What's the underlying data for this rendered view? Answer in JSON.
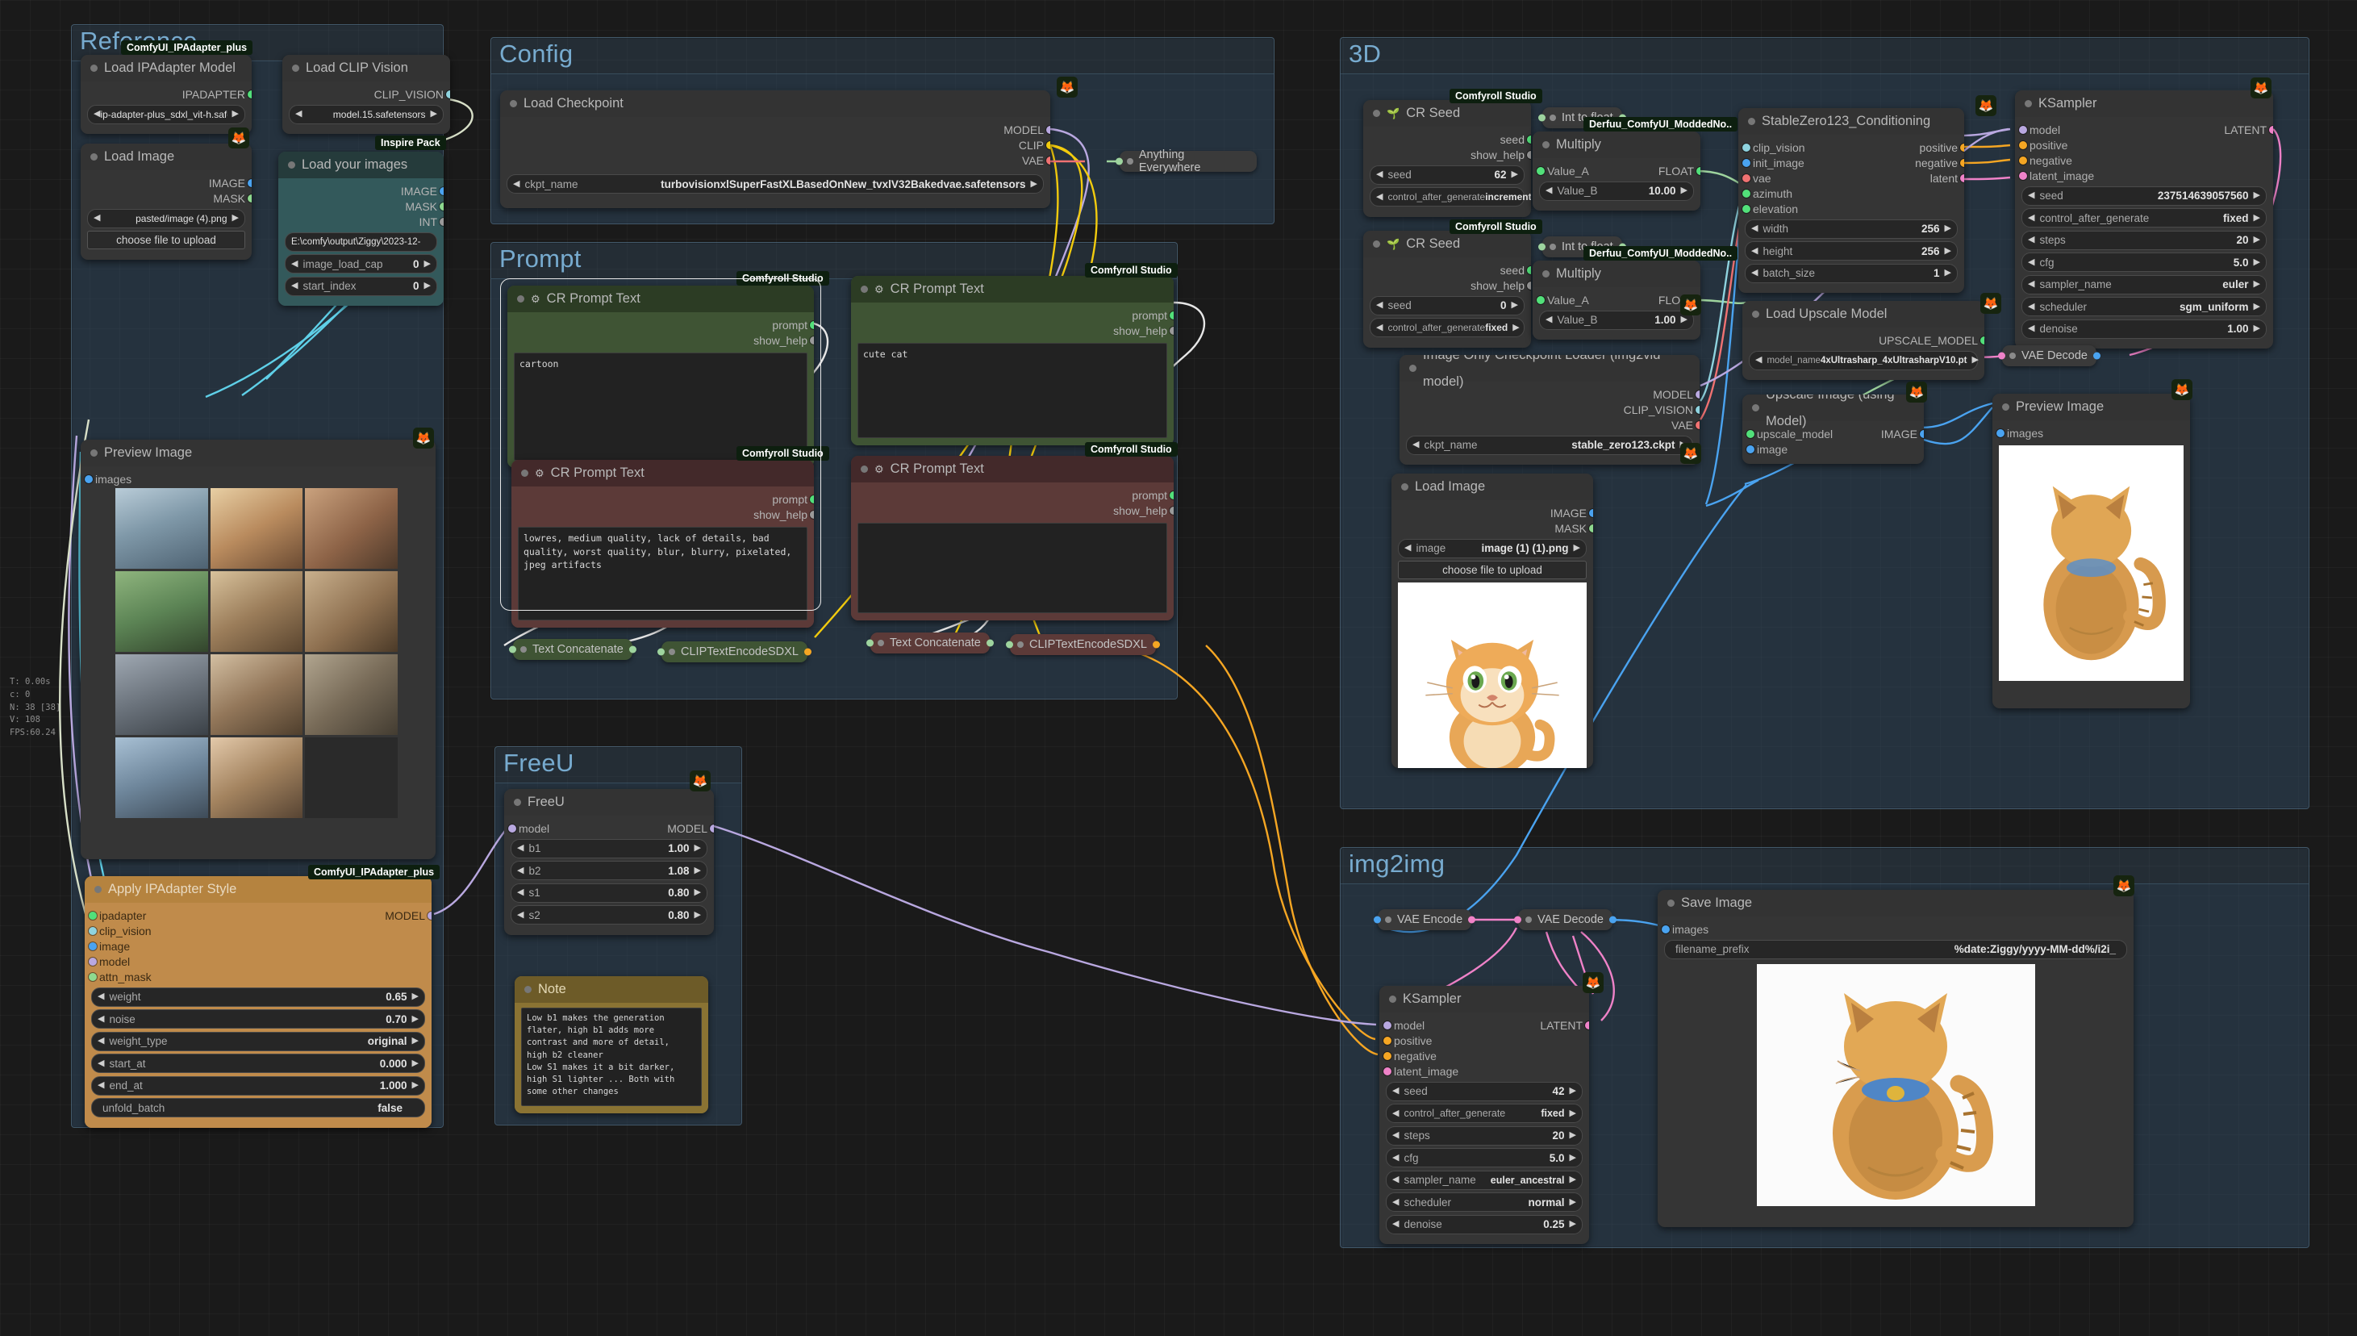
{
  "groups": [
    {
      "title": "Reference"
    },
    {
      "title": "Config"
    },
    {
      "title": "Prompt"
    },
    {
      "title": "FreeU"
    },
    {
      "title": "3D"
    },
    {
      "title": "img2img"
    }
  ],
  "badges": {
    "ipadapter_plus": "ComfyUI_IPAdapter_plus",
    "inspire_pack": "Inspire Pack",
    "comfyroll": "Comfyroll Studio",
    "derfuu": "Derfuu_ComfyUI_ModdedNo.."
  },
  "reference": {
    "load_ipadapter_model": {
      "title": "Load IPAdapter Model",
      "output": "IPADAPTER",
      "ipadapter_file": "ip-adapter-plus_sdxl_vit-h.safetensors"
    },
    "load_image": {
      "title": "Load Image",
      "out_image": "IMAGE",
      "out_mask": "MASK",
      "image_value": "pasted/image (4).png",
      "upload_label": "choose file to upload"
    },
    "load_clip_vision": {
      "title": "Load CLIP Vision",
      "output": "CLIP_VISION",
      "clip_name": "model.15.safetensors"
    },
    "load_your_images": {
      "title": "Load your images",
      "out_image": "IMAGE",
      "out_mask": "MASK",
      "out_int": "INT",
      "directory": "E:\\comfy\\output\\Ziggy\\2023-12-",
      "image_load_cap_label": "image_load_cap",
      "image_load_cap": "0",
      "start_index_label": "start_index",
      "start_index": "0"
    },
    "preview_image": {
      "title": "Preview Image",
      "input": "images"
    },
    "apply_ipadapter_style": {
      "title": "Apply IPAdapter Style",
      "inputs": [
        "ipadapter",
        "clip_vision",
        "image",
        "model",
        "attn_mask"
      ],
      "output": "MODEL",
      "widgets": [
        {
          "label": "weight",
          "value": "0.65"
        },
        {
          "label": "noise",
          "value": "0.70"
        },
        {
          "label": "weight_type",
          "value": "original"
        },
        {
          "label": "start_at",
          "value": "0.000"
        },
        {
          "label": "end_at",
          "value": "1.000"
        }
      ],
      "toggle_label": "unfold_batch",
      "toggle_value": "false"
    },
    "stats": "T: 0.00s\nc: 0\nN: 38 [38]\nV: 108\nFPS:60.24"
  },
  "config": {
    "load_checkpoint": {
      "title": "Load Checkpoint",
      "outputs": [
        "MODEL",
        "CLIP",
        "VAE"
      ],
      "ckpt_label": "ckpt_name",
      "ckpt_name": "turbovisionxlSuperFastXLBasedOnNew_tvxlV32Bakedvae.safetensors"
    },
    "anything_everywhere": {
      "title": "Anything Everywhere"
    }
  },
  "prompt": {
    "nodes": [
      {
        "title": "CR Prompt Text",
        "out1": "prompt",
        "out2": "show_help",
        "text": "cartoon",
        "color": "green"
      },
      {
        "title": "CR Prompt Text",
        "out1": "prompt",
        "out2": "show_help",
        "text": "cute cat",
        "color": "green"
      },
      {
        "title": "CR Prompt Text",
        "out1": "prompt",
        "out2": "show_help",
        "text": "lowres, medium quality, lack of details, bad quality, worst quality, blur, blurry, pixelated, jpeg artifacts",
        "color": "red"
      },
      {
        "title": "CR Prompt Text",
        "out1": "prompt",
        "out2": "show_help",
        "text": "",
        "color": "red"
      }
    ],
    "concat_pos": "Text Concatenate",
    "encode_pos": "CLIPTextEncodeSDXL",
    "concat_neg": "Text Concatenate",
    "encode_neg": "CLIPTextEncodeSDXL"
  },
  "freeu": {
    "node": {
      "title": "FreeU",
      "input": "model",
      "output": "MODEL",
      "widgets": [
        {
          "label": "b1",
          "value": "1.00"
        },
        {
          "label": "b2",
          "value": "1.08"
        },
        {
          "label": "s1",
          "value": "0.80"
        },
        {
          "label": "s2",
          "value": "0.80"
        }
      ]
    },
    "note": {
      "title": "Note",
      "text": "Low b1 makes the generation flater, high b1 adds more contrast and more of detail,\nhigh b2 cleaner\nLow S1 makes it a bit darker, high S1 lighter ... Both with some other changes"
    }
  },
  "threed": {
    "cr_seed_1": {
      "title": "CR Seed",
      "out_seed": "seed",
      "out_help": "show_help",
      "seed_label": "seed",
      "seed_value": "62",
      "control_label": "control_after_generate",
      "control_value": "increment"
    },
    "cr_seed_2": {
      "title": "CR Seed",
      "out_seed": "seed",
      "out_help": "show_help",
      "seed_label": "seed",
      "seed_value": "0",
      "control_label": "control_after_generate",
      "control_value": "fixed"
    },
    "int_to_float_1": {
      "title": "Int to float"
    },
    "int_to_float_2": {
      "title": "Int to float"
    },
    "multiply_1": {
      "title": "Multiply",
      "input": "Value_A",
      "output": "FLOAT",
      "value_b_label": "Value_B",
      "value_b": "10.00"
    },
    "multiply_2": {
      "title": "Multiply",
      "input": "Value_A",
      "output": "FLOAT",
      "value_b_label": "Value_B",
      "value_b": "1.00"
    },
    "stablezero123": {
      "title": "StableZero123_Conditioning",
      "inputs": [
        "clip_vision",
        "init_image",
        "vae",
        "azimuth",
        "elevation"
      ],
      "outputs": [
        "positive",
        "negative",
        "latent"
      ],
      "widgets": [
        {
          "label": "width",
          "value": "256"
        },
        {
          "label": "height",
          "value": "256"
        },
        {
          "label": "batch_size",
          "value": "1"
        }
      ]
    },
    "ksampler": {
      "title": "KSampler",
      "inputs": [
        "model",
        "positive",
        "negative",
        "latent_image"
      ],
      "output": "LATENT",
      "widgets": [
        {
          "label": "seed",
          "value": "237514639057560"
        },
        {
          "label": "control_after_generate",
          "value": "fixed"
        },
        {
          "label": "steps",
          "value": "20"
        },
        {
          "label": "cfg",
          "value": "5.0"
        },
        {
          "label": "sampler_name",
          "value": "euler"
        },
        {
          "label": "scheduler",
          "value": "sgm_uniform"
        },
        {
          "label": "denoise",
          "value": "1.00"
        }
      ]
    },
    "img_only_ckpt_loader": {
      "title": "Image Only Checkpoint Loader (img2vid model)",
      "outputs": [
        "MODEL",
        "CLIP_VISION",
        "VAE"
      ],
      "ckpt_label": "ckpt_name",
      "ckpt_name": "stable_zero123.ckpt"
    },
    "load_upscale_model": {
      "title": "Load Upscale Model",
      "output": "UPSCALE_MODEL",
      "model_label": "model_name",
      "model_name": "4xUltrasharp_4xUltrasharpV10.pt"
    },
    "upscale_image": {
      "title": "Upscale Image (using Model)",
      "inputs": [
        "upscale_model",
        "image"
      ],
      "output": "IMAGE"
    },
    "vae_decode": {
      "title": "VAE Decode"
    },
    "load_image": {
      "title": "Load Image",
      "out_image": "IMAGE",
      "out_mask": "MASK",
      "image_label": "image",
      "image_value": "image (1) (1).png",
      "upload_label": "choose file to upload"
    },
    "preview_image": {
      "title": "Preview Image",
      "input": "images"
    }
  },
  "img2img": {
    "vae_encode": {
      "title": "VAE Encode"
    },
    "vae_decode": {
      "title": "VAE Decode"
    },
    "save_image": {
      "title": "Save Image",
      "input": "images",
      "prefix_label": "filename_prefix",
      "prefix_value": "%date:Ziggy/yyyy-MM-dd%/i2i_"
    },
    "ksampler": {
      "title": "KSampler",
      "inputs": [
        "model",
        "positive",
        "negative",
        "latent_image"
      ],
      "output": "LATENT",
      "widgets": [
        {
          "label": "seed",
          "value": "42"
        },
        {
          "label": "control_after_generate",
          "value": "fixed"
        },
        {
          "label": "steps",
          "value": "20"
        },
        {
          "label": "cfg",
          "value": "5.0"
        },
        {
          "label": "sampler_name",
          "value": "euler_ancestral"
        },
        {
          "label": "scheduler",
          "value": "normal"
        },
        {
          "label": "denoise",
          "value": "0.25"
        }
      ]
    }
  },
  "colors": {
    "group_title": "#7fb6dd",
    "green_node": "#3f5434",
    "red_node": "#5c3a38",
    "orange_node": "#c08b4b",
    "note": "#8a7333"
  }
}
